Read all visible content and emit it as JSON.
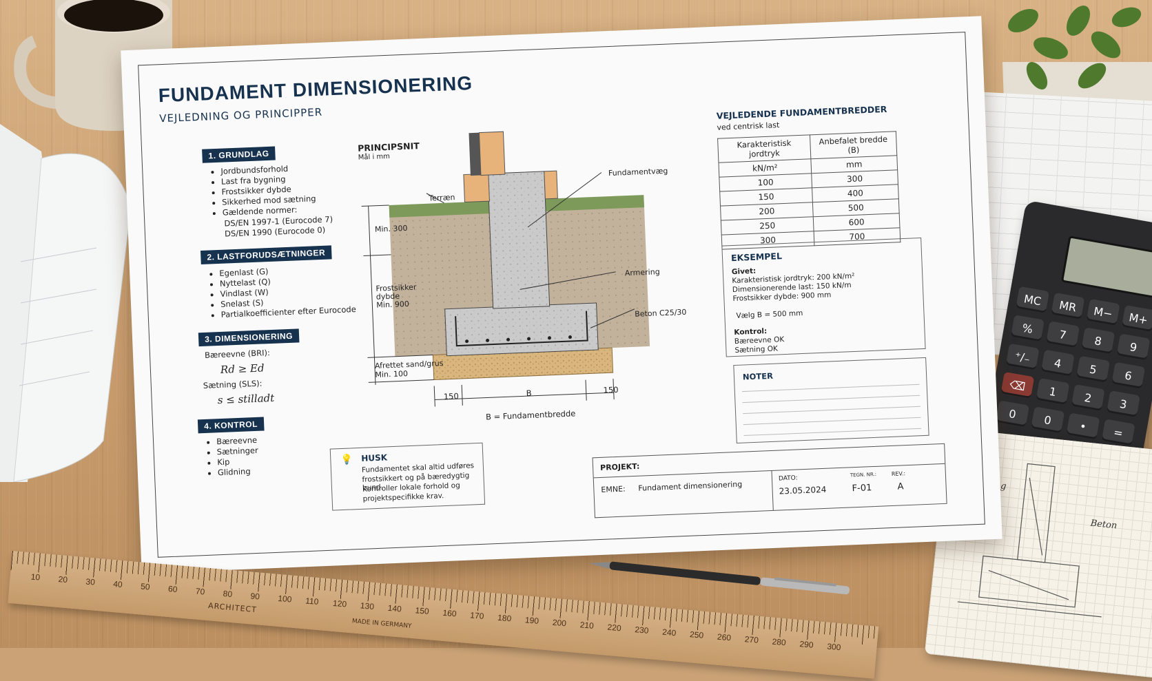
{
  "sheet": {
    "title": "FUNDAMENT DIMENSIONERING",
    "subtitle": "VEJLEDNING OG PRINCIPPER"
  },
  "section1": {
    "heading": "1. GRUNDLAG",
    "items": [
      "Jordbundsforhold",
      "Last fra bygning",
      "Frostsikker dybde",
      "Sikkerhed mod sætning",
      "Gældende normer:"
    ],
    "norm1": "DS/EN 1997-1 (Eurocode 7)",
    "norm2": "DS/EN 1990 (Eurocode 0)"
  },
  "section2": {
    "heading": "2. LASTFORUDSÆTNINGER",
    "items": [
      "Egenlast (G)",
      "Nyttelast (Q)",
      "Vindlast (W)",
      "Snelast (S)",
      "Partialkoefficienter efter Eurocode"
    ]
  },
  "section3": {
    "heading": "3. DIMENSIONERING",
    "uls_label": "Bæreevne (BRI):",
    "uls_formula": "Rd ≥ Ed",
    "sls_label": "Sætning (SLS):",
    "sls_formula": "s ≤ stilladt"
  },
  "section4": {
    "heading": "4. KONTROL",
    "items": [
      "Bæreevne",
      "Sætninger",
      "Kip",
      "Glidning"
    ]
  },
  "section_drawing": {
    "heading": "PRINCIPSNIT",
    "units": "Mål i mm",
    "terrain": "Terræn",
    "wall": "Fundamentvæg",
    "reinforcement": "Armering",
    "concrete": "Beton C25/30",
    "min300": "Min. 300",
    "frost_line1": "Frostsikker",
    "frost_line2": "dybde",
    "frost_line3": "Min. 900",
    "sand_line1": "Afrettet sand/grus",
    "sand_line2": "Min. 100",
    "dim_left": "150",
    "dim_b": "B",
    "dim_right": "150",
    "caption": "B = Fundamentbredde"
  },
  "husk": {
    "heading": "HUSK",
    "line1": "Fundamentet skal altid udføres",
    "line2": "frostsikkert og på bæredygtig bund.",
    "line3": "Kontroller lokale forhold og",
    "line4": "projektspecifikke krav."
  },
  "table": {
    "heading": "VEJLEDENDE FUNDAMENTBREDDER",
    "subheading": "ved centrisk last",
    "col1": "Karakteristisk jordtryk",
    "col1_unit": "kN/m²",
    "col2": "Anbefalet bredde (B)",
    "col2_unit": "mm",
    "rows": [
      [
        "100",
        "300"
      ],
      [
        "150",
        "400"
      ],
      [
        "200",
        "500"
      ],
      [
        "250",
        "600"
      ],
      [
        "300",
        "700"
      ]
    ]
  },
  "example": {
    "heading": "EKSEMPEL",
    "given": "Givet:",
    "line1": "Karakteristisk jordtryk:  200 kN/m²",
    "line2": "Dimensionerende last:  150 kN/m",
    "line3": "Frostsikker dybde:   900 mm",
    "choose": "Vælg B = 500 mm",
    "check": "Kontrol:",
    "check1": "Bæreevne OK",
    "check2": "Sætning OK"
  },
  "notes": {
    "heading": "NOTER"
  },
  "titleblock": {
    "project_label": "PROJEKT:",
    "subject_label": "EMNE:",
    "subject_value": "Fundament dimensionering",
    "date_label": "DATO:",
    "date_value": "23.05.2024",
    "drawing_label": "TEGN. NR.:",
    "drawing_value": "F-01",
    "rev_label": "REV.:",
    "rev_value": "A"
  },
  "desk": {
    "calculator_keys": [
      "MC",
      "MR",
      "M−",
      "M+",
      "%",
      "7",
      "8",
      "9",
      "⁺∕₋",
      "4",
      "5",
      "6",
      "⌫",
      "1",
      "2",
      "3",
      "0",
      "0",
      "•",
      "="
    ],
    "ruler_numbers": [
      "10",
      "20",
      "30",
      "40",
      "50",
      "60",
      "70",
      "80",
      "90",
      "100",
      "110",
      "120",
      "130",
      "140",
      "150",
      "160",
      "170",
      "180",
      "190",
      "200",
      "210",
      "220",
      "230",
      "240",
      "250",
      "260",
      "270",
      "280",
      "290",
      "300"
    ],
    "ruler_brand": "ARCHITECT",
    "ruler_made": "MADE IN GERMANY",
    "notebook_label1": "Armering",
    "notebook_label2": "Beton"
  },
  "colors": {
    "navy": "#16324f",
    "paper": "#fafafa",
    "wood": "#caa276",
    "concrete": "#c7c7c7",
    "gravel": "#d8b67e",
    "grass": "#7d9a5a"
  }
}
